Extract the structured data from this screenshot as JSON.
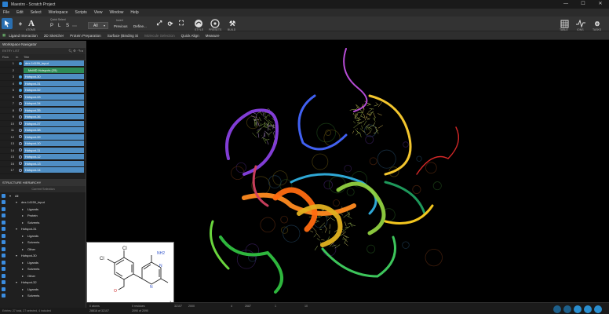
{
  "titlebar": {
    "title": "Maestro - Scratch Project",
    "minimize": "—",
    "maximize": "☐",
    "close": "✕"
  },
  "menu": [
    "File",
    "Edit",
    "Select",
    "Workspace",
    "Scripts",
    "View",
    "Window",
    "Help"
  ],
  "toolbar": {
    "quick_select_label": "Quick Select",
    "quick_select_letters": [
      "P",
      "L",
      "S"
    ],
    "all_label": "All",
    "invert_label": "Invert",
    "previous_label": "Previous",
    "define_label": "Define...",
    "style_label": "STYLE",
    "presets_label": "PRESETS",
    "build_label": "BUILD",
    "table_label": "TABLE",
    "ions_label": "IONS",
    "tasks_label": "TASKS",
    "atoms_label": "ATOMS"
  },
  "favorites": [
    "Ligand Interaction",
    "2D Sketcher",
    "Protein Preparation",
    "Surface (Binding Si",
    "Molecule Selection",
    "Quick Align",
    "Measure"
  ],
  "navigator": {
    "title": "Workspace Navigator",
    "entry_list_label": "ENTRY LIST",
    "columns": [
      "Row",
      "In",
      "Title"
    ],
    "entries": [
      {
        "row": "1",
        "title": "dex-14159_input"
      },
      {
        "row": "2",
        "title": "MxMD Hotspots (25)"
      },
      {
        "row": "3",
        "title": "Hotspot-30"
      },
      {
        "row": "4",
        "title": "Hotspot-31"
      },
      {
        "row": "5",
        "title": "Hotspot-32"
      },
      {
        "row": "6",
        "title": "Hotspot-33"
      },
      {
        "row": "7",
        "title": "Hotspot-34"
      },
      {
        "row": "8",
        "title": "Hotspot-35"
      },
      {
        "row": "9",
        "title": "Hotspot-36"
      },
      {
        "row": "10",
        "title": "Hotspot-37"
      },
      {
        "row": "11",
        "title": "Hotspot-38"
      },
      {
        "row": "12",
        "title": "Hotspot-39"
      },
      {
        "row": "13",
        "title": "Hotspot-10"
      },
      {
        "row": "14",
        "title": "Hotspot-11"
      },
      {
        "row": "15",
        "title": "Hotspot-12"
      },
      {
        "row": "16",
        "title": "Hotspot-13"
      },
      {
        "row": "17",
        "title": "Hotspot-14"
      }
    ]
  },
  "hierarchy": {
    "title": "STRUCTURE HIERARCHY",
    "current_selection": "Current Selection",
    "rows": [
      {
        "label": "All",
        "level": 0
      },
      {
        "label": "dex-14159_input",
        "level": 1
      },
      {
        "label": "Ligands",
        "level": 2
      },
      {
        "label": "Protein",
        "level": 2
      },
      {
        "label": "Solvents",
        "level": 2
      },
      {
        "label": "Hotspot-31",
        "level": 1
      },
      {
        "label": "Ligands",
        "level": 2
      },
      {
        "label": "Solvents",
        "level": 2
      },
      {
        "label": "Other",
        "level": 2
      },
      {
        "label": "Hotspot-30",
        "level": 1
      },
      {
        "label": "Ligands",
        "level": 2
      },
      {
        "label": "Solvents",
        "level": 2
      },
      {
        "label": "Other",
        "level": 2
      },
      {
        "label": "Hotspot-32",
        "level": 1
      },
      {
        "label": "Ligands",
        "level": 2
      },
      {
        "label": "Solvents",
        "level": 2
      }
    ]
  },
  "structure_box": {
    "count": "1/680",
    "atoms": {
      "cl1": "Cl",
      "cl2": "Cl",
      "nh2": "NH2",
      "n1": "N",
      "n2": "N",
      "o": "O"
    }
  },
  "status": {
    "left": "Entries: 27 total, 27 selected, 4 included",
    "items": [
      {
        "k": "SELECTED",
        "v": "0 atoms"
      },
      {
        "k": "",
        "v": "28816 of 32107"
      },
      {
        "k": "",
        "v": "0 residues"
      },
      {
        "k": "",
        "v": "2090 of 2090"
      },
      {
        "k": "ATOMS",
        "v": "32107"
      },
      {
        "k": "RESIDUES",
        "v": "2000"
      },
      {
        "k": "CHAINS",
        "v": "4"
      },
      {
        "k": "",
        "v": "2687"
      },
      {
        "k": "MOLECULES",
        "v": "1"
      },
      {
        "k": "ENTRIES",
        "v": "10"
      }
    ]
  },
  "colors": {
    "accent": "#4f8ec4",
    "group": "#2e8b57",
    "panel": "#1f1f1f",
    "toolbar": "#333333"
  }
}
